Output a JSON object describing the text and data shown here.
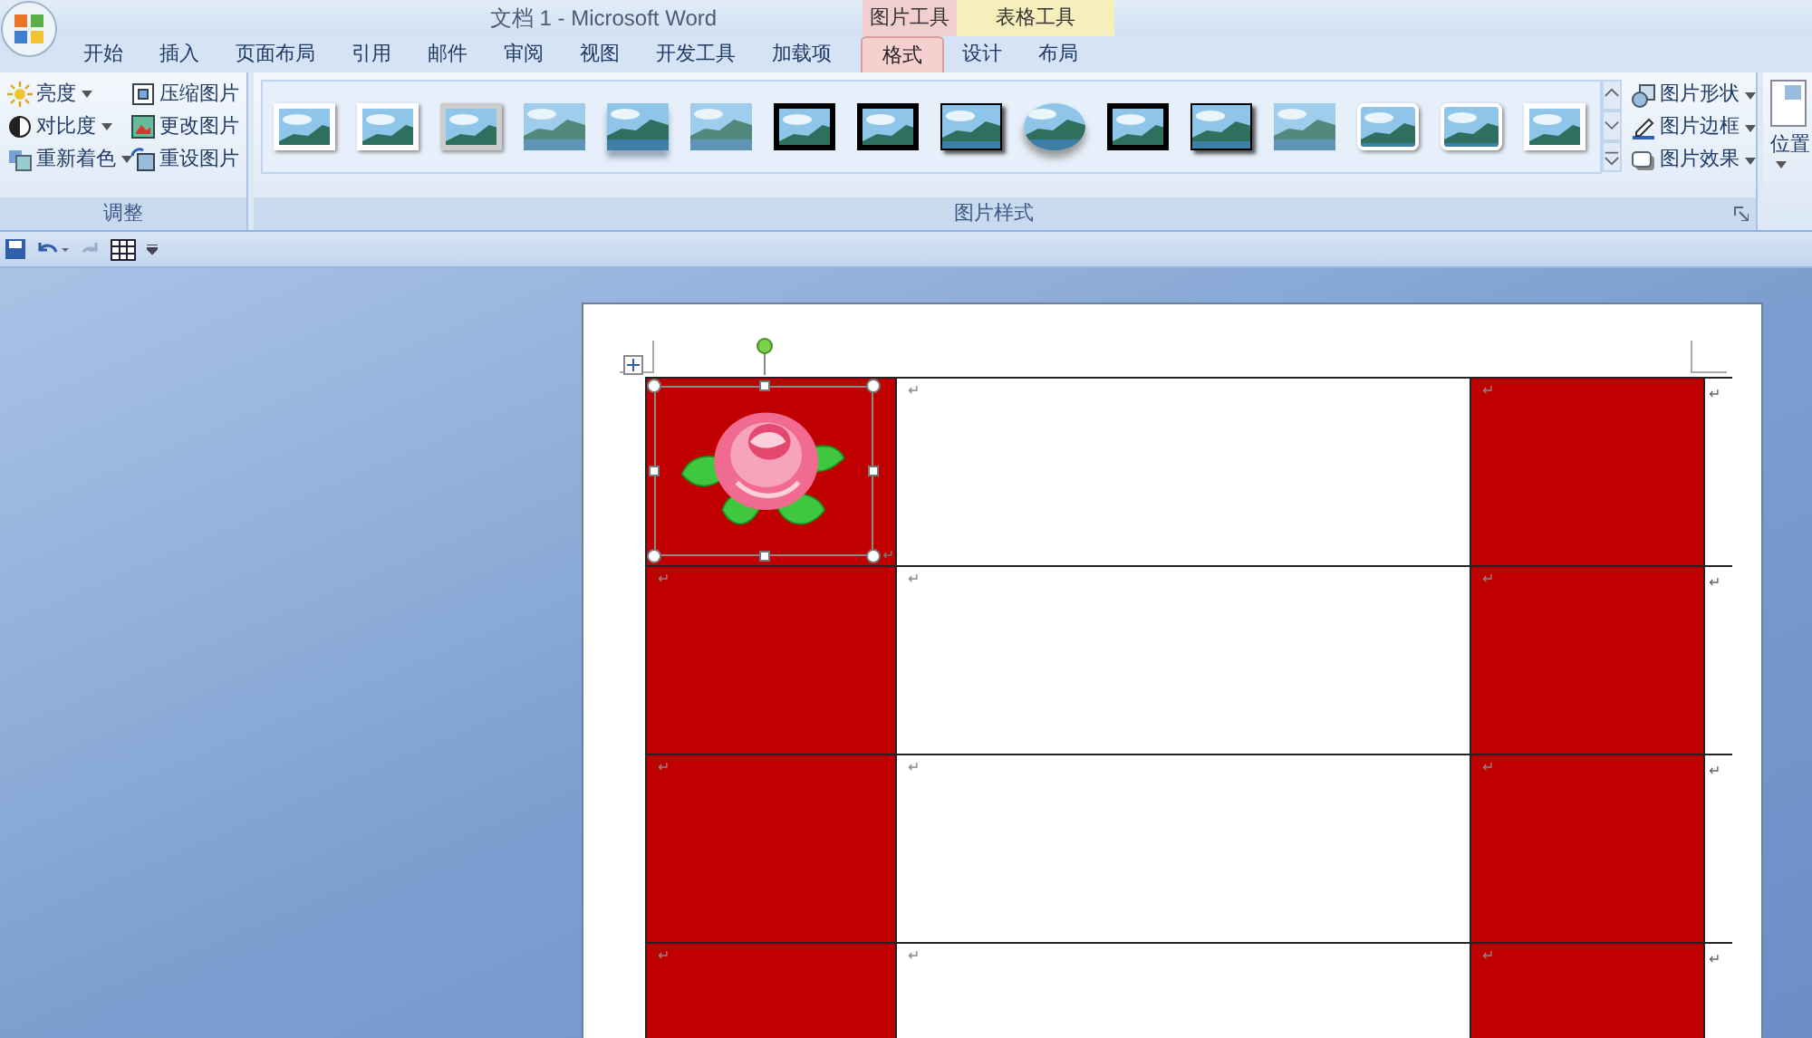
{
  "window": {
    "title": "文档 1 - Microsoft Word"
  },
  "contextual_groups": [
    {
      "label": "图片工具",
      "color": "#f2cfcf"
    },
    {
      "label": "表格工具",
      "color": "#f6eebb"
    }
  ],
  "tabs": [
    {
      "label": "开始",
      "selected": false
    },
    {
      "label": "插入",
      "selected": false
    },
    {
      "label": "页面布局",
      "selected": false
    },
    {
      "label": "引用",
      "selected": false
    },
    {
      "label": "邮件",
      "selected": false
    },
    {
      "label": "审阅",
      "selected": false
    },
    {
      "label": "视图",
      "selected": false
    },
    {
      "label": "开发工具",
      "selected": false
    },
    {
      "label": "加载项",
      "selected": false
    },
    {
      "label": "格式",
      "selected": true
    },
    {
      "label": "设计",
      "selected": false
    },
    {
      "label": "布局",
      "selected": false
    }
  ],
  "adjust_group": {
    "label": "调整",
    "buttons": [
      {
        "kind": "brightness",
        "label": "亮度",
        "dropdown": true
      },
      {
        "kind": "compress",
        "label": "压缩图片",
        "dropdown": false
      },
      {
        "kind": "contrast",
        "label": "对比度",
        "dropdown": true
      },
      {
        "kind": "change",
        "label": "更改图片",
        "dropdown": false
      },
      {
        "kind": "recolor",
        "label": "重新着色",
        "dropdown": true
      },
      {
        "kind": "reset",
        "label": "重设图片",
        "dropdown": false
      }
    ]
  },
  "styles_group": {
    "label": "图片样式",
    "gallery": [
      {
        "kind": "white-frame"
      },
      {
        "kind": "white-frame"
      },
      {
        "kind": "gray-frame"
      },
      {
        "kind": "soft"
      },
      {
        "kind": "reflection"
      },
      {
        "kind": "soft"
      },
      {
        "kind": "black-frame"
      },
      {
        "kind": "black-frame"
      },
      {
        "kind": "thin-frame"
      },
      {
        "kind": "oval"
      },
      {
        "kind": "black-frame"
      },
      {
        "kind": "thin-frame"
      },
      {
        "kind": "soft"
      },
      {
        "kind": "rounded"
      },
      {
        "kind": "rounded"
      },
      {
        "kind": "white-frame"
      }
    ],
    "buttons": [
      {
        "kind": "shape",
        "label": "图片形状"
      },
      {
        "kind": "border",
        "label": "图片边框"
      },
      {
        "kind": "effect",
        "label": "图片效果"
      }
    ]
  },
  "arrange_group": {
    "buttons": [
      {
        "label": "位置"
      }
    ]
  },
  "quick_access": [
    {
      "kind": "save",
      "disabled": false
    },
    {
      "kind": "undo",
      "disabled": false
    },
    {
      "kind": "redo",
      "disabled": true
    },
    {
      "kind": "grid",
      "disabled": false
    },
    {
      "kind": "customize",
      "disabled": false
    }
  ],
  "table": {
    "rows": [
      {
        "end_mark": "↵",
        "cells": [
          {
            "color": "#c00000",
            "mark": "↵",
            "image": {
              "kind": "rose",
              "selected": true
            }
          },
          {
            "color": "#ffffff",
            "mark": "↵"
          },
          {
            "color": "#c00000",
            "mark": "↵"
          }
        ]
      },
      {
        "end_mark": "↵",
        "cells": [
          {
            "color": "#c00000",
            "mark": "↵"
          },
          {
            "color": "#ffffff",
            "mark": "↵"
          },
          {
            "color": "#c00000",
            "mark": "↵"
          }
        ]
      },
      {
        "end_mark": "↵",
        "cells": [
          {
            "color": "#c00000",
            "mark": "↵"
          },
          {
            "color": "#ffffff",
            "mark": "↵"
          },
          {
            "color": "#c00000",
            "mark": "↵"
          }
        ]
      },
      {
        "end_mark": "↵",
        "cells": [
          {
            "color": "#c00000",
            "mark": "↵"
          },
          {
            "color": "#ffffff",
            "mark": "↵"
          },
          {
            "color": "#c00000",
            "mark": "↵"
          }
        ]
      }
    ]
  }
}
